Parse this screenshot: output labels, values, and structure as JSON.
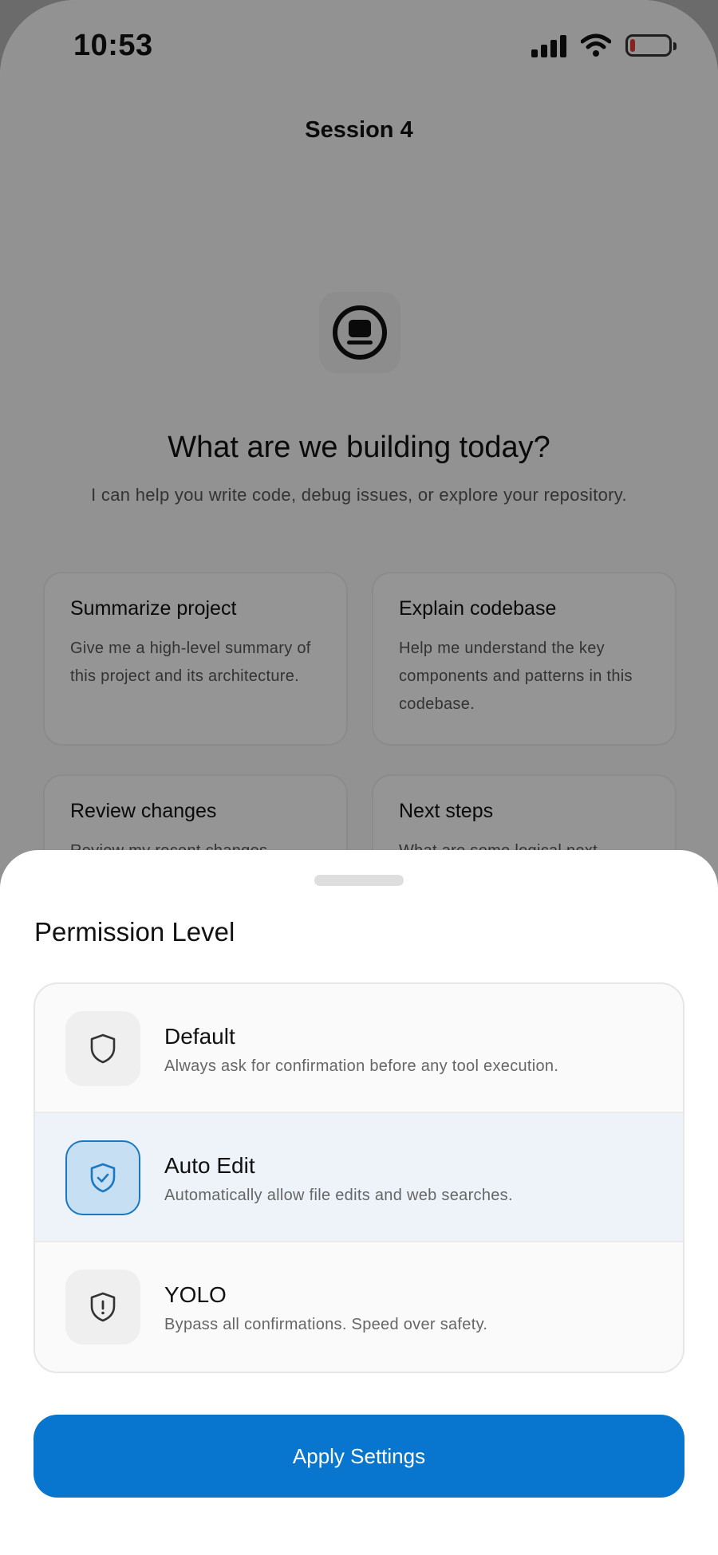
{
  "status_bar": {
    "time": "10:53"
  },
  "nav": {
    "title": "Session 4"
  },
  "hero": {
    "title": "What are we building today?",
    "subtitle": "I can help you write code, debug issues, or explore your repository."
  },
  "suggestions": [
    {
      "title": "Summarize project",
      "body": "Give me a high-level summary of this project and its architecture."
    },
    {
      "title": "Explain codebase",
      "body": "Help me understand the key components and patterns in this codebase."
    },
    {
      "title": "Review changes",
      "body": "Review my recent changes"
    },
    {
      "title": "Next steps",
      "body": "What are some logical next"
    }
  ],
  "sheet": {
    "title": "Permission Level",
    "options": [
      {
        "label": "Default",
        "description": "Always ask for confirmation before any tool execution.",
        "icon": "shield-icon",
        "selected": false
      },
      {
        "label": "Auto Edit",
        "description": "Automatically allow file edits and web searches.",
        "icon": "shield-check-icon",
        "selected": true
      },
      {
        "label": "YOLO",
        "description": "Bypass all confirmations. Speed over safety.",
        "icon": "shield-alert-icon",
        "selected": false
      }
    ],
    "apply_label": "Apply Settings"
  },
  "colors": {
    "accent": "#0876cf",
    "selected_bg": "#eef3f9",
    "battery_low": "#e53935"
  }
}
